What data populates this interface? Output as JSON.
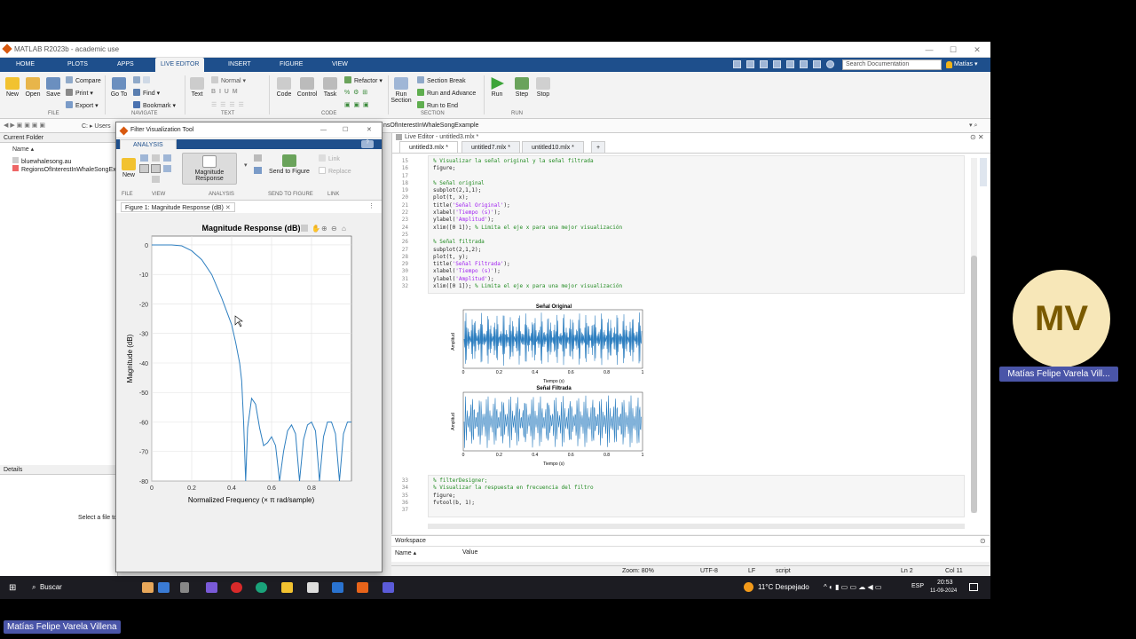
{
  "window": {
    "title": "MATLAB R2023b - academic use"
  },
  "tabs": [
    "HOME",
    "PLOTS",
    "APPS",
    "LIVE EDITOR",
    "INSERT",
    "FIGURE",
    "VIEW"
  ],
  "search_placeholder": "Search Documentation",
  "user": "Matías ▾",
  "ribbon": {
    "file": {
      "new": "New",
      "open": "Open",
      "save": "Save",
      "compare": "Compare",
      "print": "Print",
      "export": "Export",
      "label": "FILE"
    },
    "navigate": {
      "goto": "Go To",
      "find": "Find",
      "bookmark": "Bookmark",
      "label": "NAVIGATE"
    },
    "text": {
      "style": "Normal",
      "text": "Text",
      "label": "TEXT"
    },
    "code": {
      "code": "Code",
      "control": "Control",
      "task": "Task",
      "refactor": "Refactor",
      "label": "CODE"
    },
    "section": {
      "run_section": "Run Section",
      "break": "Section Break",
      "run_advance": "Run and Advance",
      "run_end": "Run to End",
      "label": "SECTION"
    },
    "run": {
      "run": "Run",
      "step": "Step",
      "stop": "Stop",
      "label": "RUN"
    }
  },
  "address": {
    "path": "C: ▸ Users",
    "tail": "nsOfInterestInWhaleSongExample"
  },
  "left_panel": {
    "header": "Current Folder",
    "col_name": "Name ▴",
    "files": [
      "bluewhalesong.au",
      "RegionsOfInterestInWhaleSongExa"
    ],
    "details": "Details",
    "select_msg": "Select a file to"
  },
  "fvtool": {
    "title": "Filter Visualization Tool",
    "tab": "ANALYSIS",
    "new": "New",
    "magnitude_response": "Magnitude Response",
    "send_to_figure": "Send to Figure",
    "link": "Link",
    "replace": "Replace",
    "groups": {
      "file": "FILE",
      "view": "VIEW",
      "analysis": "ANALYSIS",
      "send": "SEND TO FIGURE",
      "link": "LINK"
    },
    "figure_tab": "Figure 1: Magnitude Response (dB)"
  },
  "chart_data": {
    "type": "line",
    "title": "Magnitude Response (dB)",
    "xlabel": "Normalized  Frequency  (× π  rad/sample)",
    "ylabel": "Magnitude (dB)",
    "xlim": [
      0,
      1
    ],
    "ylim": [
      -80,
      3
    ],
    "xticks": [
      "0",
      "0.2",
      "0.4",
      "0.6",
      "0.8"
    ],
    "yticks": [
      "0",
      "-10",
      "-20",
      "-30",
      "-40",
      "-50",
      "-60",
      "-70",
      "-80"
    ],
    "grid": true,
    "series": [
      {
        "x": [
          0,
          0.1,
          0.15,
          0.2,
          0.25,
          0.3,
          0.35,
          0.4,
          0.42,
          0.44,
          0.45,
          0.46,
          0.47,
          0.48,
          0.5,
          0.52,
          0.54,
          0.56,
          0.58,
          0.6,
          0.62,
          0.64,
          0.66,
          0.68,
          0.7,
          0.72,
          0.74,
          0.76,
          0.78,
          0.8,
          0.82,
          0.84,
          0.86,
          0.88,
          0.9,
          0.92,
          0.94,
          0.96,
          0.98,
          1.0
        ],
        "y": [
          0,
          0,
          -0.3,
          -2,
          -5,
          -10,
          -18,
          -27,
          -33,
          -40,
          -46,
          -60,
          -80,
          -62,
          -52,
          -54,
          -62,
          -68,
          -67,
          -65,
          -68,
          -80,
          -70,
          -63,
          -61,
          -64,
          -80,
          -66,
          -61,
          -60,
          -63,
          -80,
          -65,
          -60,
          -60,
          -64,
          -80,
          -64,
          -60,
          -60
        ]
      }
    ]
  },
  "editor": {
    "title": "Live Editor - untitled3.mlx *",
    "tabs": [
      "untitled3.mlx *",
      "untitled7.mlx *",
      "untitled10.mlx *",
      "+"
    ],
    "lines1": [
      "15",
      "16",
      "17",
      "18",
      "19",
      "20",
      "21",
      "22",
      "23",
      "24",
      "25",
      "26",
      "27",
      "28",
      "29",
      "30",
      "31",
      "32"
    ],
    "lines2": [
      "33",
      "34",
      "35",
      "36",
      "37"
    ],
    "plot1_title": "Señal Original",
    "plot2_title": "Señal Filtrada",
    "xlabel": "Tiempo (s)",
    "ylabel": "Amplitud",
    "ticks_x": [
      "0",
      "0.2",
      "0.4",
      "0.6",
      "0.8",
      "1"
    ]
  },
  "workspace": {
    "title": "Workspace",
    "col_name": "Name ▴",
    "col_value": "Value"
  },
  "status": {
    "zoom": "Zoom: 80%",
    "enc": "UTF-8",
    "eol": "LF",
    "type": "script",
    "ln": "Ln  2",
    "col": "Col  11"
  },
  "taskbar": {
    "search": "Buscar",
    "weather": "11°C  Despejado",
    "lang": "ESP",
    "time": "20:53",
    "date": "11-09-2024"
  },
  "participant": {
    "initials": "MV",
    "name": "Matías Felipe Varela Vill...",
    "full": "Matías Felipe Varela Villena"
  }
}
